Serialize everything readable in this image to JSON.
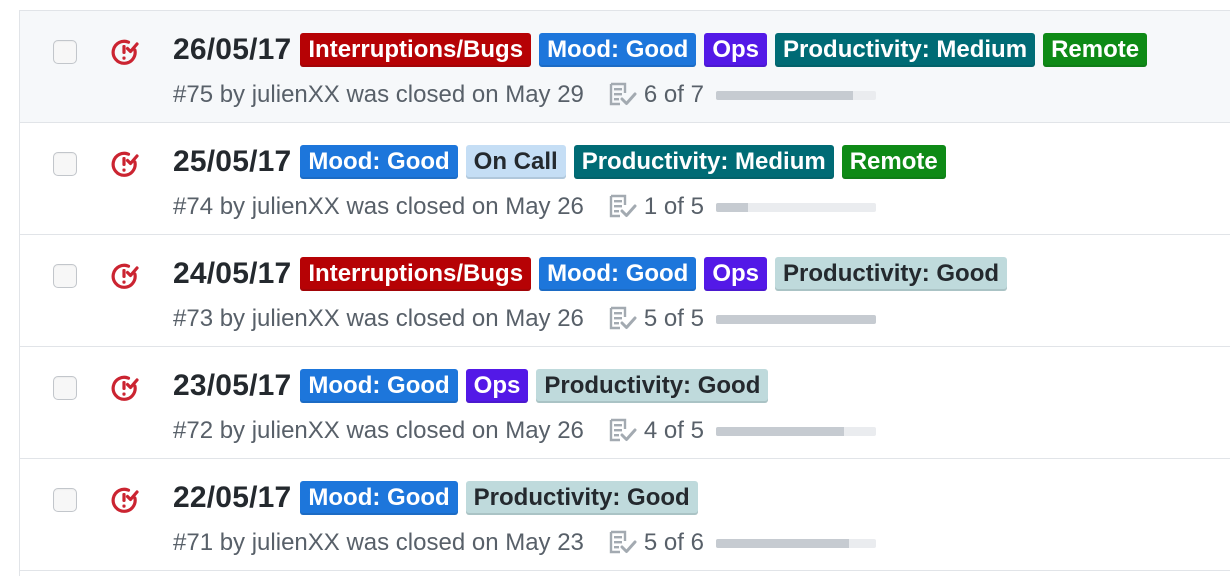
{
  "issues": [
    {
      "title": "26/05/17",
      "labels": [
        {
          "name": "Interruptions/Bugs",
          "bg": "#b60205",
          "fg": "#ffffff"
        },
        {
          "name": "Mood: Good",
          "bg": "#1d76db",
          "fg": "#ffffff"
        },
        {
          "name": "Ops",
          "bg": "#5319e7",
          "fg": "#ffffff"
        },
        {
          "name": "Productivity: Medium",
          "bg": "#006b75",
          "fg": "#ffffff"
        },
        {
          "name": "Remote",
          "bg": "#0e8a16",
          "fg": "#ffffff"
        }
      ],
      "meta": "#75 by julienXX was closed on May 29",
      "tasks": "6 of 7",
      "progress": 0.857
    },
    {
      "title": "25/05/17",
      "labels": [
        {
          "name": "Mood: Good",
          "bg": "#1d76db",
          "fg": "#ffffff"
        },
        {
          "name": "On Call",
          "bg": "#c5def5",
          "fg": "#24292e"
        },
        {
          "name": "Productivity: Medium",
          "bg": "#006b75",
          "fg": "#ffffff"
        },
        {
          "name": "Remote",
          "bg": "#0e8a16",
          "fg": "#ffffff"
        }
      ],
      "meta": "#74 by julienXX was closed on May 26",
      "tasks": "1 of 5",
      "progress": 0.2
    },
    {
      "title": "24/05/17",
      "labels": [
        {
          "name": "Interruptions/Bugs",
          "bg": "#b60205",
          "fg": "#ffffff"
        },
        {
          "name": "Mood: Good",
          "bg": "#1d76db",
          "fg": "#ffffff"
        },
        {
          "name": "Ops",
          "bg": "#5319e7",
          "fg": "#ffffff"
        },
        {
          "name": "Productivity: Good",
          "bg": "#bfdadc",
          "fg": "#24292e"
        }
      ],
      "meta": "#73 by julienXX was closed on May 26",
      "tasks": "5 of 5",
      "progress": 1.0
    },
    {
      "title": "23/05/17",
      "labels": [
        {
          "name": "Mood: Good",
          "bg": "#1d76db",
          "fg": "#ffffff"
        },
        {
          "name": "Ops",
          "bg": "#5319e7",
          "fg": "#ffffff"
        },
        {
          "name": "Productivity: Good",
          "bg": "#bfdadc",
          "fg": "#24292e"
        }
      ],
      "meta": "#72 by julienXX was closed on May 26",
      "tasks": "4 of 5",
      "progress": 0.8
    },
    {
      "title": "22/05/17",
      "labels": [
        {
          "name": "Mood: Good",
          "bg": "#1d76db",
          "fg": "#ffffff"
        },
        {
          "name": "Productivity: Good",
          "bg": "#bfdadc",
          "fg": "#24292e"
        }
      ],
      "meta": "#71 by julienXX was closed on May 23",
      "tasks": "5 of 6",
      "progress": 0.833
    }
  ],
  "icons": {
    "state": "issue-closed-icon",
    "tasks": "tasklist-icon"
  },
  "colors": {
    "closed_icon": "#cb2431"
  }
}
